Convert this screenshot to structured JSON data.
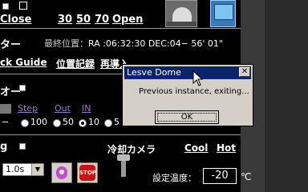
{
  "dome_row": {
    "label": "Close",
    "links": [
      "30",
      "50",
      "70",
      "Open"
    ]
  },
  "telescope": {
    "title": "ター",
    "last_position_label": "最終位置：",
    "position": "RA :06:32:30 DEC:04− 56' 01\""
  },
  "menu_row": {
    "items": [
      "ck Guide",
      "位置記録",
      "再導入"
    ]
  },
  "focuser": {
    "title": "オー",
    "step_label": "Step",
    "out_label": "Out",
    "in_label": "IN",
    "steps": [
      "100",
      "50",
      "10",
      "5"
    ],
    "selected_step": "10"
  },
  "camera": {
    "title": "冷却カメラ",
    "cool_label": "Cool",
    "hot_label": "Hot",
    "set_temp_label": "設定温度：",
    "set_temp_value": "-20",
    "unit": "℃"
  },
  "exposure": {
    "value": "1.0s",
    "section_label": "g"
  },
  "dialog": {
    "title": "Lesve Dome",
    "message": "Previous instance, exiting...",
    "ok_label": "OK",
    "close_glyph": "✕"
  },
  "icons": {
    "close_glyph": "✕",
    "stop_label": "STOP"
  },
  "colors": {
    "background": "#000000",
    "dialog_title": "#0a246a",
    "dialog_face": "#d4d0c8"
  }
}
